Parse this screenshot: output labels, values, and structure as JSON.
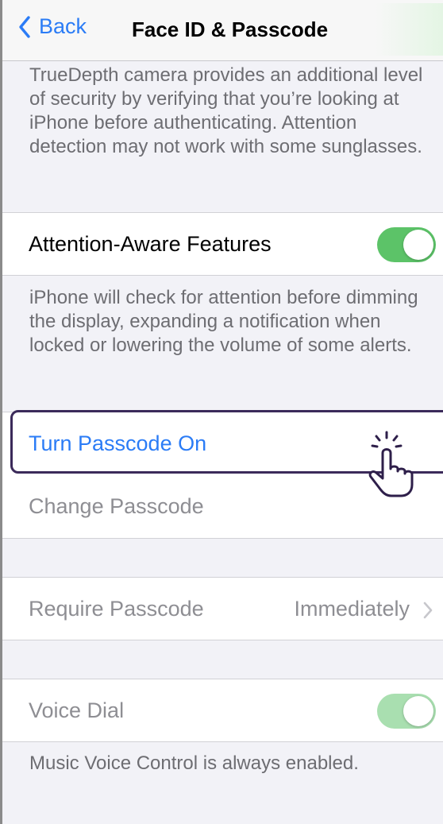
{
  "navbar": {
    "back_label": "Back",
    "title": "Face ID & Passcode"
  },
  "footers": {
    "truedepth": "TrueDepth camera provides an additional level of security by verifying that you’re looking at iPhone before authenticating. Attention detection may not work with some sunglasses.",
    "attention": "iPhone will check for attention before dimming the display, expanding a notification when locked or lowering the volume of some alerts.",
    "voice": "Music Voice Control is always enabled."
  },
  "rows": {
    "attention_aware": {
      "label": "Attention-Aware Features",
      "toggle_on": true
    },
    "turn_passcode_on": {
      "label": "Turn Passcode On"
    },
    "change_passcode": {
      "label": "Change Passcode"
    },
    "require_passcode": {
      "label": "Require Passcode",
      "value": "Immediately"
    },
    "voice_dial": {
      "label": "Voice Dial",
      "toggle_on": true
    }
  },
  "colors": {
    "accent_blue": "#2b7cf6",
    "toggle_green": "#5cc368",
    "highlight_border": "#3b2a5a"
  },
  "icons": {
    "back": "chevron-left-icon",
    "disclosure": "chevron-right-icon",
    "pointer": "hand-pointer-icon"
  }
}
